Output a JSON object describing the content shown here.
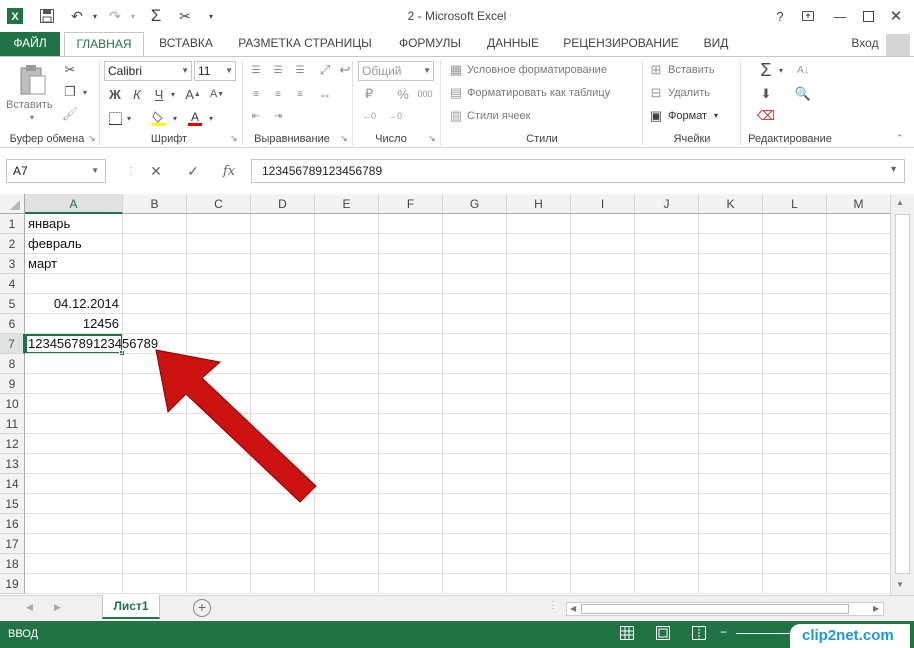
{
  "window": {
    "title": "2 - Microsoft Excel",
    "help": "?",
    "user": "Вход"
  },
  "tabs": [
    "ФАЙЛ",
    "ГЛАВНАЯ",
    "ВСТАВКА",
    "РАЗМЕТКА СТРАНИЦЫ",
    "ФОРМУЛЫ",
    "ДАННЫЕ",
    "РЕЦЕНЗИРОВАНИЕ",
    "ВИД"
  ],
  "ribbon": {
    "clipboard": {
      "label": "Буфер обмена",
      "paste": "Вставить"
    },
    "font": {
      "label": "Шрифт",
      "name": "Calibri",
      "size": "11",
      "bold": "Ж",
      "italic": "К",
      "underline": "Ч"
    },
    "alignment": {
      "label": "Выравнивание"
    },
    "number": {
      "label": "Число",
      "format": "Общий"
    },
    "styles": {
      "label": "Стили",
      "conditional": "Условное форматирование",
      "as_table": "Форматировать как таблицу",
      "cell_styles": "Стили ячеек"
    },
    "cells": {
      "label": "Ячейки",
      "insert": "Вставить",
      "delete": "Удалить",
      "format": "Формат"
    },
    "editing": {
      "label": "Редактирование"
    }
  },
  "formula_bar": {
    "name_box": "A7",
    "formula": "123456789123456789"
  },
  "columns": [
    "A",
    "B",
    "C",
    "D",
    "E",
    "F",
    "G",
    "H",
    "I",
    "J",
    "K",
    "L",
    "M"
  ],
  "rows": [
    "1",
    "2",
    "3",
    "4",
    "5",
    "6",
    "7",
    "8",
    "9",
    "10",
    "11",
    "12",
    "13",
    "14",
    "15",
    "16",
    "17",
    "18",
    "19"
  ],
  "cells": {
    "A1": "январь",
    "A2": "февраль",
    "A3": "март",
    "A5": "04.12.2014",
    "A6": "12456",
    "A7": "123456789123456789"
  },
  "sheet_tab": "Лист1",
  "status": {
    "mode": "ВВОД"
  },
  "watermark": "clip2net.com",
  "colors": {
    "accent": "#217346",
    "arrow": "#cc1111"
  }
}
